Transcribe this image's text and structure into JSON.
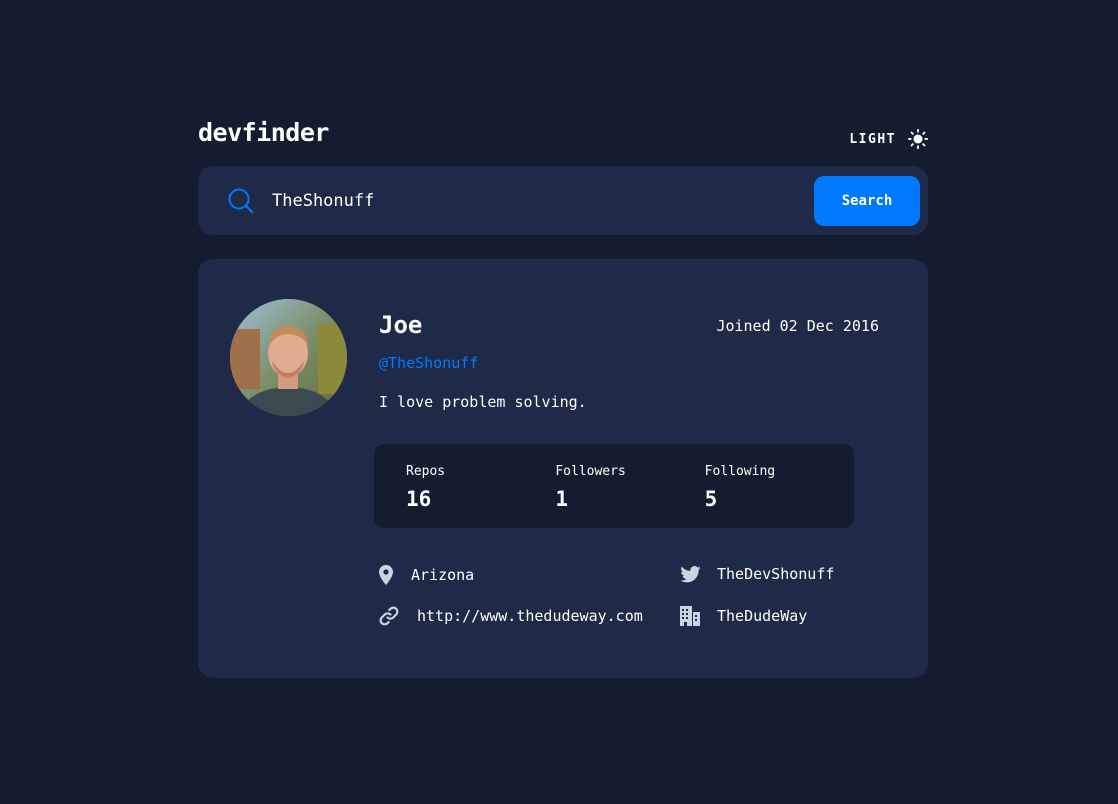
{
  "header": {
    "logo": "devfinder",
    "theme_label": "LIGHT",
    "theme_icon": "sun-icon"
  },
  "search": {
    "value": "TheShonuff",
    "button_label": "Search",
    "icon": "search-icon"
  },
  "profile": {
    "name": "Joe",
    "login": "@TheShonuff",
    "joined": "Joined 02 Dec 2016",
    "bio": "I love problem solving.",
    "stats": [
      {
        "label": "Repos",
        "value": "16"
      },
      {
        "label": "Followers",
        "value": "1"
      },
      {
        "label": "Following",
        "value": "5"
      }
    ],
    "links": {
      "location": "Arizona",
      "twitter": "TheDevShonuff",
      "blog": "http://www.thedudeway.com",
      "company": "TheDudeWay"
    }
  },
  "colors": {
    "background": "#141d2f",
    "card": "#1e2a47",
    "accent": "#0079ff",
    "text": "#ffffff",
    "icon": "#cbd5e1"
  }
}
